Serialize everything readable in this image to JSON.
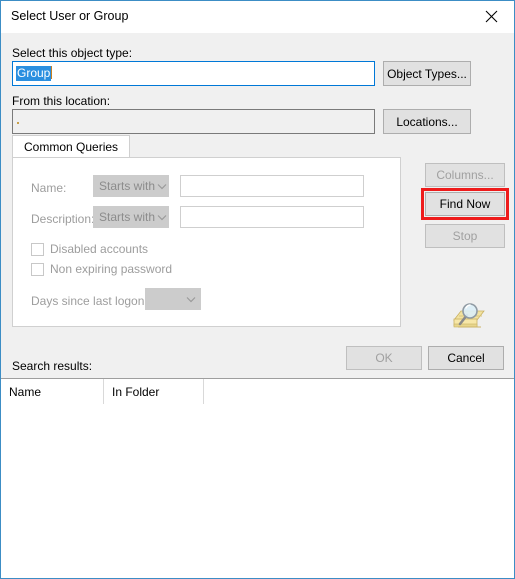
{
  "window": {
    "title": "Select User or Group",
    "close_icon": "close-icon"
  },
  "object_type": {
    "label": "Select this object type:",
    "value": "Group",
    "button_label": "Object Types..."
  },
  "location": {
    "label": "From this location:",
    "value": "",
    "button_label": "Locations..."
  },
  "tabs": [
    {
      "label": "Common Queries"
    }
  ],
  "common_queries": {
    "name": {
      "label": "Name:",
      "condition": "Starts with",
      "value": ""
    },
    "description": {
      "label": "Description:",
      "condition": "Starts with",
      "value": ""
    },
    "disabled_accounts": {
      "label": "Disabled accounts",
      "checked": false
    },
    "non_expiring_password": {
      "label": "Non expiring password",
      "checked": false
    },
    "days_since_last_logon": {
      "label": "Days since last logon:",
      "value": ""
    }
  },
  "side_buttons": {
    "columns_label": "Columns...",
    "find_now_label": "Find Now",
    "stop_label": "Stop",
    "find_icon": "magnifier-folder-icon",
    "highlight_color": "#ee1b1b"
  },
  "footer": {
    "ok_label": "OK",
    "cancel_label": "Cancel"
  },
  "search_results": {
    "label": "Search results:",
    "columns": [
      "Name",
      "In Folder",
      ""
    ],
    "rows": []
  },
  "colors": {
    "border": "#3c8dc5",
    "dialog_bg": "#f0f0f0",
    "accent_selection": "#2a8fe0",
    "focus_border": "#0078d7",
    "highlight": "#ee1b1b"
  }
}
